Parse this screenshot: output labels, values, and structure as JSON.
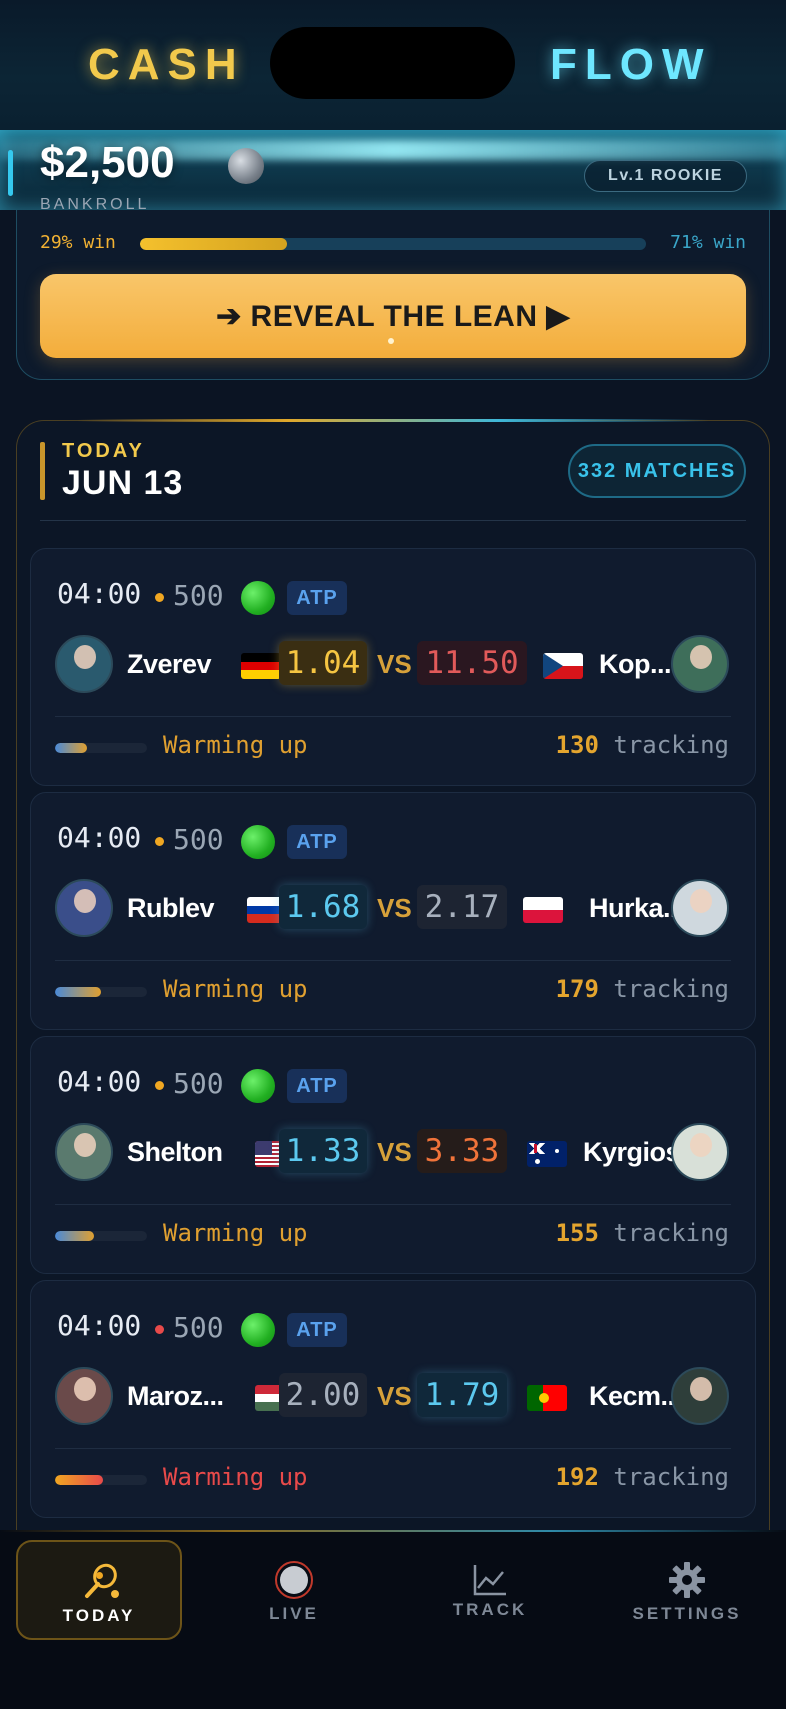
{
  "header": {
    "brand_left": "CASH",
    "brand_right": "FLOW"
  },
  "bankroll": {
    "amount": "$2,500",
    "label": "BANKROLL",
    "level": "Lv.1 ROOKIE"
  },
  "lean": {
    "left_win": "29% win",
    "right_win": "71% win",
    "left_fraction": 0.29,
    "button": "➔ REVEAL THE LEAN ▶"
  },
  "today": {
    "label": "TODAY",
    "date": "JUN 13",
    "matches": "332 MATCHES"
  },
  "colors": {
    "gold": "#f2c94c",
    "cyan": "#39c2ea",
    "live_green": "#22b022",
    "warn_red": "#e84a4a"
  },
  "matches": [
    {
      "time": "04:00",
      "dot_color": "#f0a722",
      "tier": "500",
      "tour": "ATP",
      "p1": {
        "name": "Zverev",
        "flag": "germany"
      },
      "p2": {
        "name": "Kop...",
        "flag": "czechia"
      },
      "odds1": "1.04",
      "odds2": "11.50",
      "vs": "VS",
      "odds1_style": "gold",
      "odds2_style": "red",
      "status": "Warming up",
      "status_color": "#e0a030",
      "progress": 0.35,
      "tracking_count": "130",
      "tracking_label": "tracking"
    },
    {
      "time": "04:00",
      "dot_color": "#f0a722",
      "tier": "500",
      "tour": "ATP",
      "p1": {
        "name": "Rublev",
        "flag": "russia"
      },
      "p2": {
        "name": "Hurka...",
        "flag": "poland"
      },
      "odds1": "1.68",
      "odds2": "2.17",
      "vs": "VS",
      "odds1_style": "cyan",
      "odds2_style": "grey",
      "status": "Warming up",
      "status_color": "#e0a030",
      "progress": 0.5,
      "tracking_count": "179",
      "tracking_label": "tracking"
    },
    {
      "time": "04:00",
      "dot_color": "#f0a722",
      "tier": "500",
      "tour": "ATP",
      "p1": {
        "name": "Shelton",
        "flag": "usa"
      },
      "p2": {
        "name": "Kyrgios",
        "flag": "australia"
      },
      "odds1": "1.33",
      "odds2": "3.33",
      "vs": "VS",
      "odds1_style": "cyan",
      "odds2_style": "orange",
      "status": "Warming up",
      "status_color": "#e0a030",
      "progress": 0.42,
      "tracking_count": "155",
      "tracking_label": "tracking"
    },
    {
      "time": "04:00",
      "dot_color": "#e84a4a",
      "tier": "500",
      "tour": "ATP",
      "p1": {
        "name": "Maroz...",
        "flag": "hungary"
      },
      "p2": {
        "name": "Kecm...",
        "flag": "portugal"
      },
      "odds1": "2.00",
      "odds2": "1.79",
      "vs": "VS",
      "odds1_style": "grey",
      "odds2_style": "cyan",
      "status": "Warming up",
      "status_color": "#e84a4a",
      "progress": 0.52,
      "tracking_count": "192",
      "tracking_label": "tracking"
    }
  ],
  "nav": [
    {
      "label": "TODAY",
      "icon": "tennis-racket-icon",
      "active": true
    },
    {
      "label": "LIVE",
      "icon": "live-record-icon",
      "active": false
    },
    {
      "label": "TRACK",
      "icon": "chart-line-icon",
      "active": false
    },
    {
      "label": "SETTINGS",
      "icon": "gear-icon",
      "active": false
    }
  ]
}
